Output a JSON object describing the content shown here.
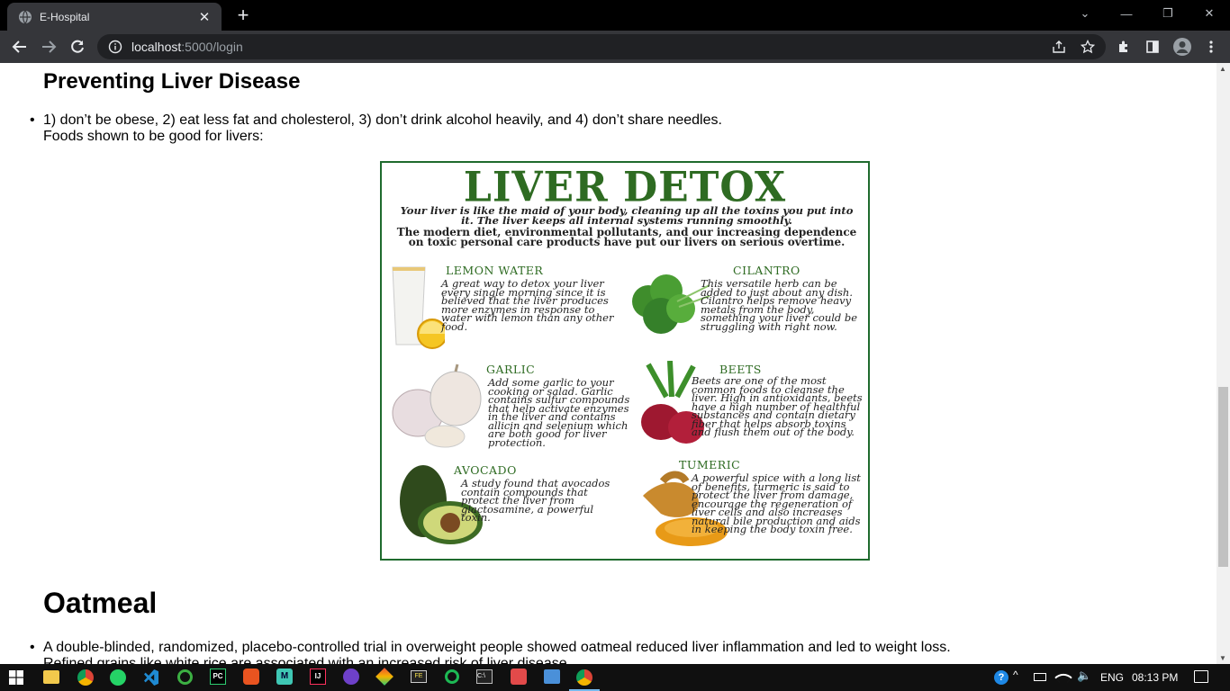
{
  "browser": {
    "tab_title": "E-Hospital",
    "new_tab": "+",
    "url_host": "localhost",
    "url_path": ":5000/login"
  },
  "page": {
    "section_title": "Preventing Liver Disease",
    "prevention_text": "1) don’t be obese, 2) eat less fat and cholesterol, 3) don’t drink alcohol heavily, and 4) don’t share needles.",
    "foods_intro": "Foods shown to be good for livers:",
    "poster": {
      "title": "LIVER DETOX",
      "intro_1": "Your liver is like the maid of your body, cleaning up all the toxins you put into it. The liver keeps all internal systems running smoothly.",
      "intro_2": "The modern diet, environmental pollutants, and our increasing dependence on toxic personal care products have put our livers on serious overtime.",
      "items": [
        {
          "name": "LEMON WATER",
          "text": "A great way to detox your liver every single morning since it is believed that the liver produces more enzymes in response to water with lemon than any other food."
        },
        {
          "name": "CILANTRO",
          "text": "This versatile herb can be added to just about any dish. Cilantro helps remove heavy metals from the body, something your liver could be struggling with right now."
        },
        {
          "name": "GARLIC",
          "text": "Add some garlic to your cooking or salad. Garlic contains sulfur compounds that help activate enzymes in the liver and contains allicin and selenium which are both good for liver protection."
        },
        {
          "name": "BEETS",
          "text": "Beets are one of the most common foods to cleanse the liver. High in antioxidants, beets have a high number of healthful substances and contain dietary fiber that helps absorb toxins and flush them out of the body."
        },
        {
          "name": "AVOCADO",
          "text": "A study found that avocados contain compounds that protect the liver from glactosamine, a powerful toxin."
        },
        {
          "name": "TUMERIC",
          "text": "A powerful spice with a long list of benefits, turmeric is said to protect the liver from damage, encourage the regeneration of liver cells and also increases natural bile production and aids in keeping the body toxin free."
        }
      ]
    },
    "oatmeal_title": "Oatmeal",
    "oatmeal_text_1": "A double-blinded, randomized, placebo-controlled trial in overweight people showed oatmeal reduced liver inflammation and led to weight loss.",
    "oatmeal_text_2": "Refined grains like white rice are associated with an increased risk of liver disease."
  },
  "taskbar": {
    "language": "ENG",
    "time": "08:13 PM"
  },
  "colors": {
    "poster_green": "#2e6b22",
    "chrome_dark": "#35363a"
  }
}
